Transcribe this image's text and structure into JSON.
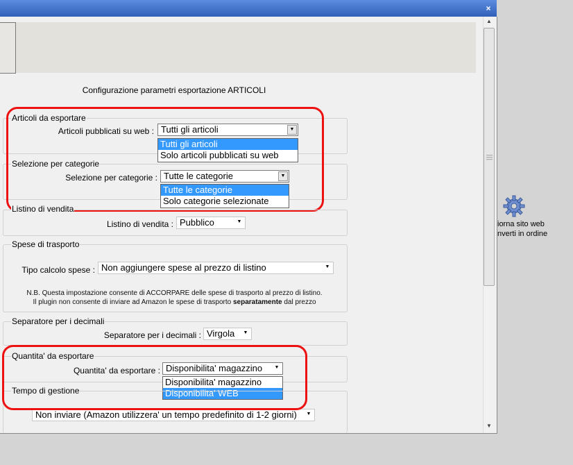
{
  "window": {
    "close_glyph": "×"
  },
  "heading": "Configurazione parametri esportazione ARTICOLI",
  "articoli": {
    "group_label": "Articoli da esportare",
    "field_label": "Articoli pubblicati su web :",
    "value": "Tutti gli articoli",
    "options": [
      "Tutti gli articoli",
      "Solo articoli pubblicati su web"
    ],
    "selected_index": 0
  },
  "categorie": {
    "group_label": "Selezione per categorie",
    "field_label": "Selezione per categorie :",
    "value": "Tutte le categorie",
    "options": [
      "Tutte le categorie",
      "Solo categorie selezionate"
    ],
    "selected_index": 0
  },
  "listino": {
    "group_label": "Listino di vendita",
    "field_label": "Listino di vendita :",
    "value": "Pubblico"
  },
  "spese": {
    "group_label": "Spese di trasporto",
    "field_label": "Tipo calcolo spese :",
    "value": "Non aggiungere spese al prezzo di listino",
    "note_line1": "N.B. Questa impostazione consente di ACCORPARE delle spese di trasporto al prezzo di listino.",
    "note_line2_pre": "Il plugin non consente di inviare ad Amazon le spese di trasporto ",
    "note_line2_bold": "separatamente",
    "note_line2_post": " dal prezzo"
  },
  "separatore": {
    "group_label": "Separatore per i decimali",
    "field_label": "Separatore per i decimali :",
    "value": "Virgola"
  },
  "quantita": {
    "group_label": "Quantita' da esportare",
    "field_label": "Quantita' da esportare :",
    "value": "Disponibilita' magazzino",
    "options": [
      "Disponibilita' magazzino",
      "Disponibilita' WEB"
    ],
    "selected_index": 1
  },
  "tempo": {
    "group_label": "Tempo di gestione",
    "value": "Non inviare (Amazon utilizzera' un tempo predefinito di 1-2 giorni)"
  },
  "desktop": {
    "icon": "gear-icon",
    "label_line1": "iorna sito web",
    "label_line2": "nverti in ordine"
  },
  "colors": {
    "highlight_box": "#e11111",
    "selection": "#3399ff",
    "titlebar": "#2f5fb8"
  }
}
